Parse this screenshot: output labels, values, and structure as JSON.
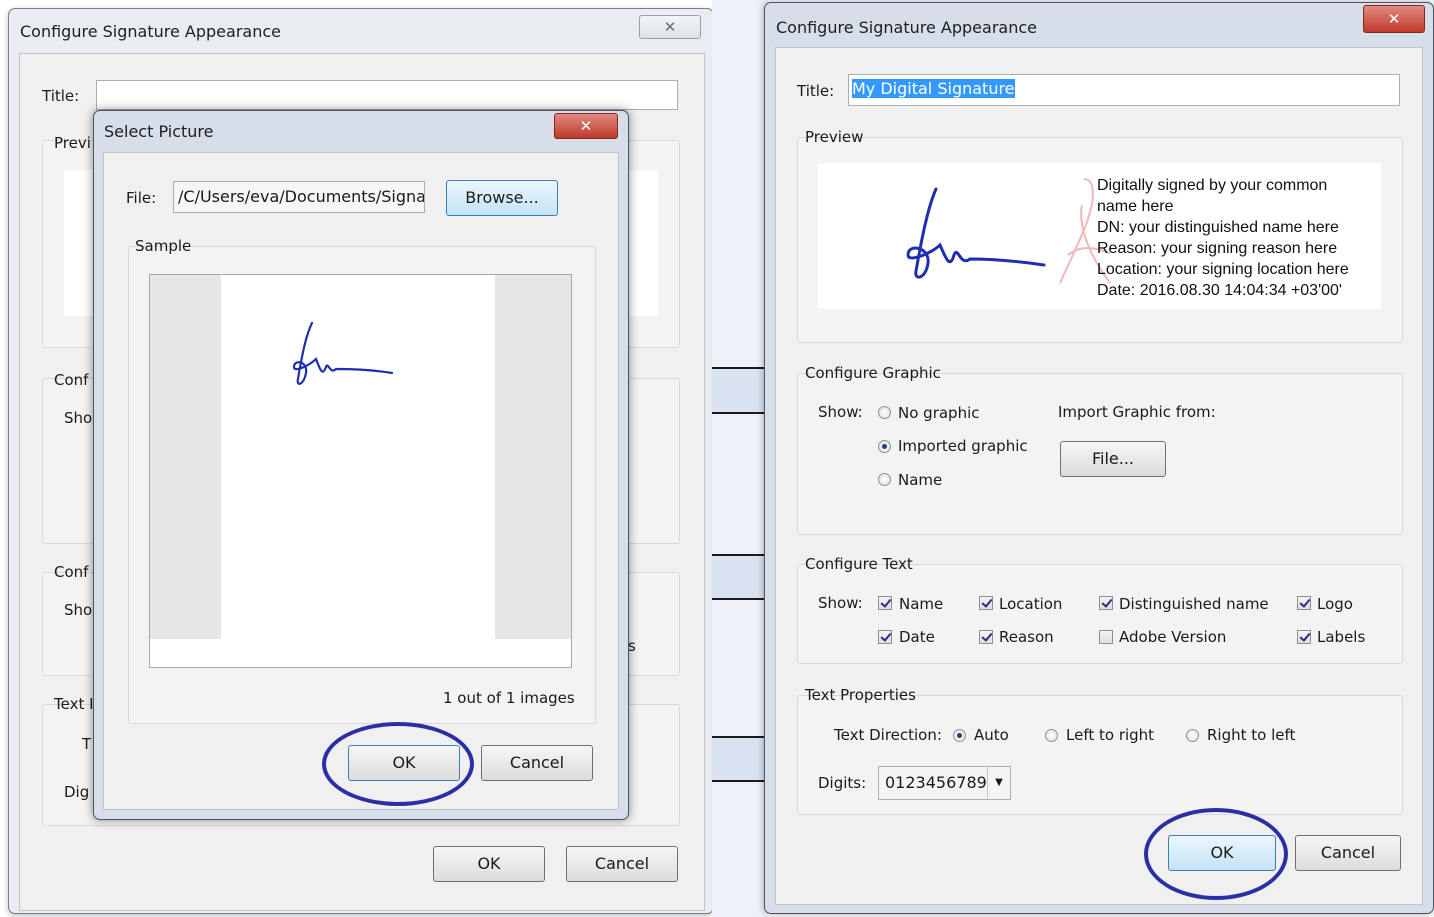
{
  "left_dialog": {
    "title": "Configure Signature Appearance",
    "title_field_label": "Title:",
    "partial_labels": [
      "Previ",
      "Conf",
      "Sho",
      "Conf",
      "Sho",
      "Text I",
      "T",
      "Dig"
    ],
    "ok": "OK",
    "cancel": "Cancel"
  },
  "select_picture": {
    "title": "Select Picture",
    "file_label": "File:",
    "file_value": "/C/Users/eva/Documents/Signatu",
    "browse": "Browse...",
    "sample_label": "Sample",
    "image_count": "1 out of 1 images",
    "ok": "OK",
    "cancel": "Cancel"
  },
  "right_dialog": {
    "title": "Configure Signature Appearance",
    "title_label": "Title:",
    "title_value": "My Digital Signature",
    "preview_label": "Preview",
    "preview_text": [
      "Digitally signed by your common",
      "name here",
      "DN: your distinguished name here",
      "Reason: your signing reason here",
      "Location: your signing location here",
      "Date: 2016.08.30 14:04:34 +03'00'"
    ],
    "graphic": {
      "label": "Configure Graphic",
      "show_label": "Show:",
      "options": [
        {
          "label": "No graphic",
          "selected": false
        },
        {
          "label": "Imported graphic",
          "selected": true
        },
        {
          "label": "Name",
          "selected": false
        }
      ],
      "import_label": "Import Graphic from:",
      "file_button": "File..."
    },
    "text": {
      "label": "Configure Text",
      "show_label": "Show:",
      "items": [
        {
          "label": "Name",
          "checked": true
        },
        {
          "label": "Location",
          "checked": true
        },
        {
          "label": "Distinguished name",
          "checked": true
        },
        {
          "label": "Logo",
          "checked": true
        },
        {
          "label": "Date",
          "checked": true
        },
        {
          "label": "Reason",
          "checked": true
        },
        {
          "label": "Adobe Version",
          "checked": false
        },
        {
          "label": "Labels",
          "checked": true
        }
      ]
    },
    "props": {
      "label": "Text Properties",
      "direction_label": "Text Direction:",
      "directions": [
        {
          "label": "Auto",
          "selected": true
        },
        {
          "label": "Left to right",
          "selected": false
        },
        {
          "label": "Right to left",
          "selected": false
        }
      ],
      "digits_label": "Digits:",
      "digits_value": "0123456789"
    },
    "ok": "OK",
    "cancel": "Cancel"
  },
  "colors": {
    "annotation_circle": "#2b2fa6",
    "close_button": "#c9463d",
    "selection": "#3399ff",
    "signature_ink": "#1d2fb0"
  }
}
